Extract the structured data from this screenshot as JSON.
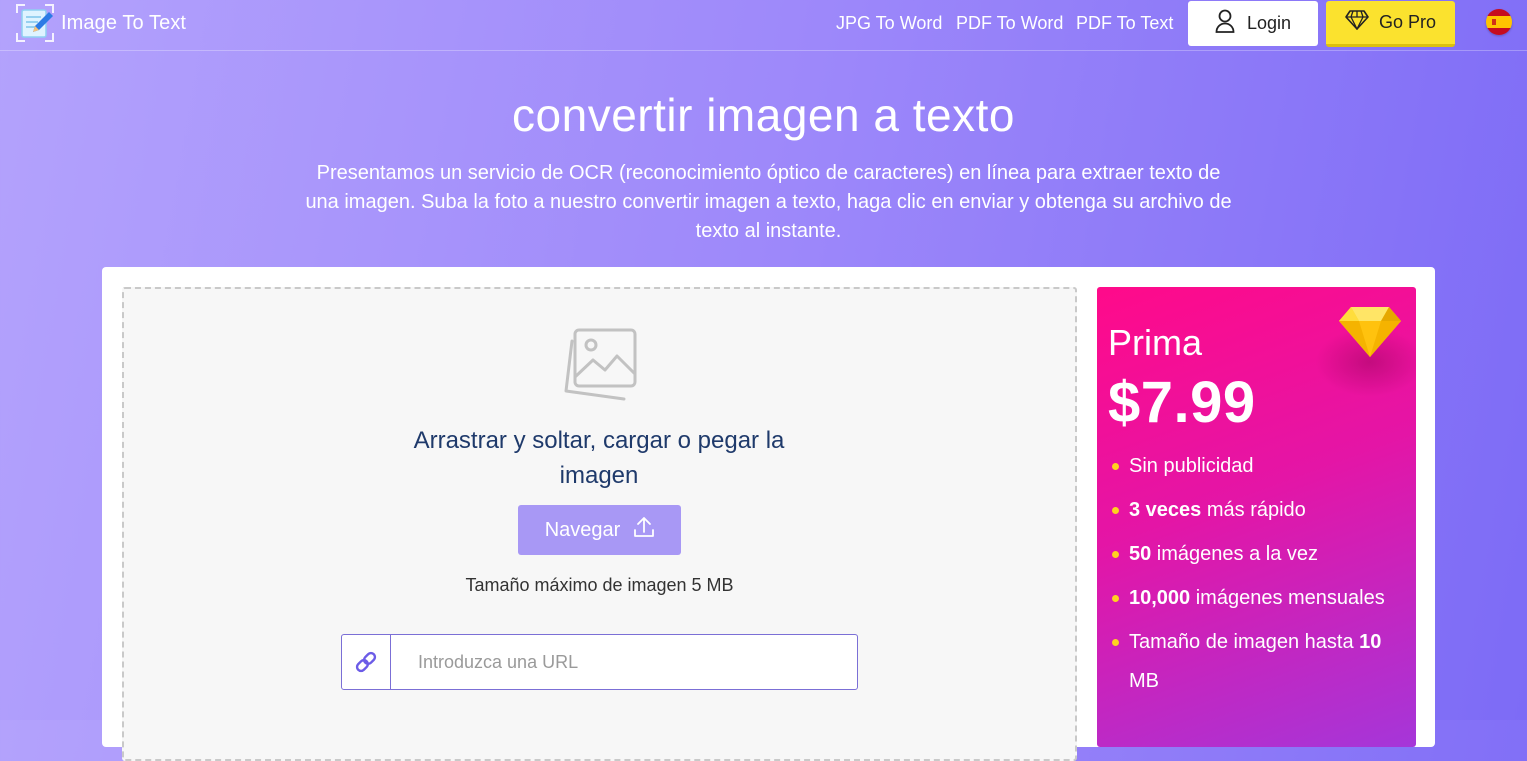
{
  "header": {
    "brand": "Image To Text",
    "nav": [
      "JPG To Word",
      "PDF To Word",
      "PDF To Text"
    ],
    "login_label": "Login",
    "gopro_label": "Go Pro",
    "lang_flag_text": "ES"
  },
  "hero": {
    "title": "convertir imagen a texto",
    "description": "Presentamos un servicio de OCR (reconocimiento óptico de caracteres) en línea para extraer texto de una imagen. Suba la foto a nuestro convertir imagen a texto, haga clic en enviar y obtenga su archivo de texto al instante."
  },
  "upload": {
    "title": "Arrastrar y soltar, cargar o pegar la imagen",
    "browse_label": "Navegar",
    "max_size": "Tamaño máximo de imagen 5 MB",
    "url_placeholder": "Introduzca una URL"
  },
  "premium": {
    "title": "Prima",
    "price": "$7.99",
    "features": [
      {
        "bold": "",
        "text": "Sin publicidad"
      },
      {
        "bold": "3 veces",
        "text": " más rápido"
      },
      {
        "bold": "50",
        "text": " imágenes a la vez"
      },
      {
        "bold": "10,000",
        "text": " imágenes mensuales"
      },
      {
        "text": "Tamaño de imagen hasta ",
        "bold_end": "10",
        "text_end": " MB"
      }
    ]
  },
  "colors": {
    "bg_start": "#b3a2fc",
    "bg_end": "#7d6bf6",
    "gopro": "#fbe22e",
    "browse_button": "#a898f5",
    "premium_start": "#ff0a8a",
    "premium_end": "#a536d9"
  },
  "icons": {
    "logo": "notepad-pencil-icon",
    "login": "user-icon",
    "gopro": "diamond-icon",
    "dropzone": "image-gallery-icon",
    "browse": "upload-icon",
    "url": "link-icon",
    "premium": "gem-icon"
  }
}
